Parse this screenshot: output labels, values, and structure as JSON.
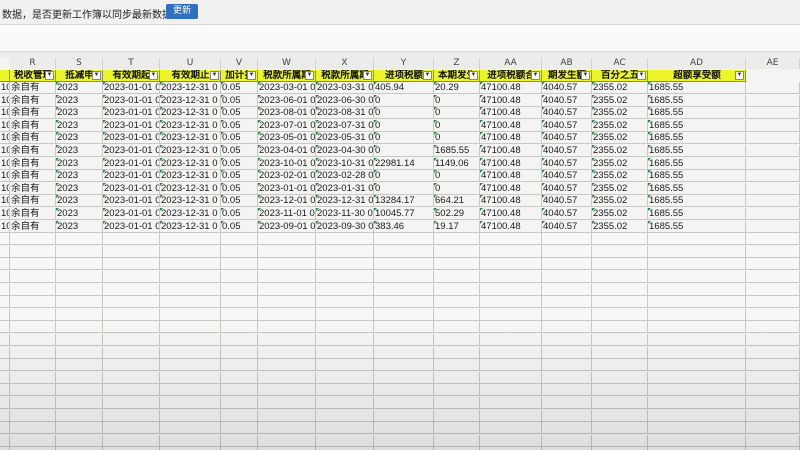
{
  "notice": {
    "message": "数据，是否更新工作簿以同步最新数据？",
    "update_button": "更新"
  },
  "columns": [
    {
      "letter": "R",
      "header": "税收管理"
    },
    {
      "letter": "S",
      "header": "抵减申"
    },
    {
      "letter": "T",
      "header": "有效期起"
    },
    {
      "letter": "U",
      "header": "有效期止"
    },
    {
      "letter": "V",
      "header": "加计扌"
    },
    {
      "letter": "W",
      "header": "税款所属期"
    },
    {
      "letter": "X",
      "header": "税款所属期"
    },
    {
      "letter": "Y",
      "header": "进项税额"
    },
    {
      "letter": "Z",
      "header": "本期发生"
    },
    {
      "letter": "AA",
      "header": "进项税额合"
    },
    {
      "letter": "AB",
      "header": "期发生额"
    },
    {
      "letter": "AC",
      "header": "百分之五"
    },
    {
      "letter": "AD",
      "header": "超额享受额"
    },
    {
      "letter": "AE",
      "header": ""
    }
  ],
  "rows": [
    [
      "余自有",
      "2023",
      "2023-01-01 0",
      "2023-12-31 0",
      "0.05",
      "2023-03-01 0",
      "2023-03-31 0",
      "405.94",
      "20.29",
      "47100.48",
      "4040.57",
      "2355.02",
      "1685.55"
    ],
    [
      "余自有",
      "2023",
      "2023-01-01 0",
      "2023-12-31 0",
      "0.05",
      "2023-06-01 0",
      "2023-06-30 0",
      "0",
      "0",
      "47100.48",
      "4040.57",
      "2355.02",
      "1685.55"
    ],
    [
      "余自有",
      "2023",
      "2023-01-01 0",
      "2023-12-31 0",
      "0.05",
      "2023-08-01 0",
      "2023-08-31 0",
      "0",
      "0",
      "47100.48",
      "4040.57",
      "2355.02",
      "1685.55"
    ],
    [
      "余自有",
      "2023",
      "2023-01-01 0",
      "2023-12-31 0",
      "0.05",
      "2023-07-01 0",
      "2023-07-31 0",
      "0",
      "0",
      "47100.48",
      "4040.57",
      "2355.02",
      "1685.55"
    ],
    [
      "余自有",
      "2023",
      "2023-01-01 0",
      "2023-12-31 0",
      "0.05",
      "2023-05-01 0",
      "2023-05-31 0",
      "0",
      "0",
      "47100.48",
      "4040.57",
      "2355.02",
      "1685.55"
    ],
    [
      "余自有",
      "2023",
      "2023-01-01 0",
      "2023-12-31 0",
      "0.05",
      "2023-04-01 0",
      "2023-04-30 0",
      "0",
      "1685.55",
      "47100.48",
      "4040.57",
      "2355.02",
      "1685.55"
    ],
    [
      "余自有",
      "2023",
      "2023-01-01 0",
      "2023-12-31 0",
      "0.05",
      "2023-10-01 0",
      "2023-10-31 0",
      "22981.14",
      "1149.06",
      "47100.48",
      "4040.57",
      "2355.02",
      "1685.55"
    ],
    [
      "余自有",
      "2023",
      "2023-01-01 0",
      "2023-12-31 0",
      "0.05",
      "2023-02-01 0",
      "2023-02-28 0",
      "0",
      "0",
      "47100.48",
      "4040.57",
      "2355.02",
      "1685.55"
    ],
    [
      "余自有",
      "2023",
      "2023-01-01 0",
      "2023-12-31 0",
      "0.05",
      "2023-01-01 0",
      "2023-01-31 0",
      "0",
      "0",
      "47100.48",
      "4040.57",
      "2355.02",
      "1685.55"
    ],
    [
      "余自有",
      "2023",
      "2023-01-01 0",
      "2023-12-31 0",
      "0.05",
      "2023-12-01 0",
      "2023-12-31 0",
      "13284.17",
      "664.21",
      "47100.48",
      "4040.57",
      "2355.02",
      "1685.55"
    ],
    [
      "余自有",
      "2023",
      "2023-01-01 0",
      "2023-12-31 0",
      "0.05",
      "2023-11-01 0",
      "2023-11-30 0",
      "10045.77",
      "502.29",
      "47100.48",
      "4040.57",
      "2355.02",
      "1685.55"
    ],
    [
      "余自有",
      "2023",
      "2023-01-01 0",
      "2023-12-31 0",
      "0.05",
      "2023-09-01 0",
      "2023-09-30 0",
      "383.46",
      "19.17",
      "47100.48",
      "4040.57",
      "2355.02",
      "1685.55"
    ]
  ],
  "row_prefix": "10",
  "colors": {
    "header_fill": "#ecf52a",
    "accent_button": "#2f6fbf",
    "flag": "#2a8a3a"
  }
}
